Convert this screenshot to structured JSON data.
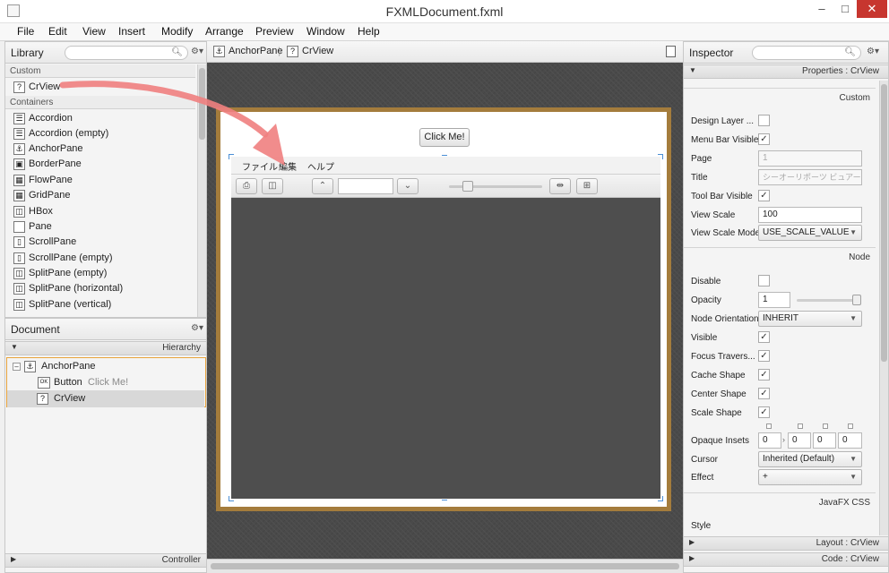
{
  "window": {
    "title": "FXMLDocument.fxml",
    "minimize": "–",
    "maximize": "□",
    "close": "✕"
  },
  "menubar": {
    "items": [
      "File",
      "Edit",
      "View",
      "Insert",
      "Modify",
      "Arrange",
      "Preview",
      "Window",
      "Help"
    ]
  },
  "library": {
    "title": "Library",
    "sections": {
      "custom": "Custom",
      "containers": "Containers"
    },
    "custom_items": [
      {
        "label": "CrView",
        "icon": "?"
      }
    ],
    "container_items": [
      {
        "label": "Accordion",
        "icon": "accordion-icon"
      },
      {
        "label": "Accordion  (empty)",
        "icon": "accordion-icon"
      },
      {
        "label": "AnchorPane",
        "icon": "anchorpane-icon"
      },
      {
        "label": "BorderPane",
        "icon": "borderpane-icon"
      },
      {
        "label": "FlowPane",
        "icon": "flowpane-icon"
      },
      {
        "label": "GridPane",
        "icon": "gridpane-icon"
      },
      {
        "label": "HBox",
        "icon": "hbox-icon"
      },
      {
        "label": "Pane",
        "icon": "pane-icon"
      },
      {
        "label": "ScrollPane",
        "icon": "scrollpane-icon"
      },
      {
        "label": "ScrollPane  (empty)",
        "icon": "scrollpane-icon"
      },
      {
        "label": "SplitPane  (empty)",
        "icon": "splitpane-icon"
      },
      {
        "label": "SplitPane  (horizontal)",
        "icon": "splitpane-icon"
      },
      {
        "label": "SplitPane  (vertical)",
        "icon": "splitpane-icon"
      }
    ]
  },
  "document": {
    "title": "Document",
    "hierarchy_label": "Hierarchy",
    "tree": {
      "root": "AnchorPane",
      "button_type": "Button",
      "button_text": "Click Me!",
      "button_badge": "OK",
      "crview": "CrView"
    },
    "controller_label": "Controller"
  },
  "breadcrumb": {
    "items": [
      "AnchorPane",
      "CrView"
    ]
  },
  "canvas": {
    "button_text": "Click Me!",
    "inner_menu": [
      "ファイル",
      "編集",
      "ヘルプ"
    ]
  },
  "inspector": {
    "title": "Inspector",
    "properties_header": "Properties : CrView",
    "sections": {
      "custom": "Custom",
      "node": "Node",
      "css": "JavaFX CSS"
    },
    "custom_props": {
      "design_layer": {
        "label": "Design Layer ..."
      },
      "menu_bar_visible": {
        "label": "Menu Bar Visible",
        "checked": "✓"
      },
      "page": {
        "label": "Page",
        "value": "1"
      },
      "title": {
        "label": "Title",
        "value": "シーオーリポーツ ビュアー"
      },
      "tool_bar_visible": {
        "label": "Tool Bar Visible",
        "checked": "✓"
      },
      "view_scale": {
        "label": "View Scale",
        "value": "100"
      },
      "view_scale_mode": {
        "label": "View Scale Mode",
        "value": "USE_SCALE_VALUE"
      }
    },
    "node_props": {
      "disable": {
        "label": "Disable"
      },
      "opacity": {
        "label": "Opacity",
        "value": "1",
        "level": 1.0
      },
      "node_orientation": {
        "label": "Node Orientation",
        "value": "INHERIT"
      },
      "visible": {
        "label": "Visible",
        "checked": "✓"
      },
      "focus_traversable": {
        "label": "Focus Travers...",
        "checked": "✓"
      },
      "cache_shape": {
        "label": "Cache Shape",
        "checked": "✓"
      },
      "center_shape": {
        "label": "Center Shape",
        "checked": "✓"
      },
      "scale_shape": {
        "label": "Scale Shape",
        "checked": "✓"
      },
      "opaque_insets": {
        "label": "Opaque Insets",
        "values": [
          "0",
          "0",
          "0",
          "0"
        ]
      },
      "cursor": {
        "label": "Cursor",
        "value": "Inherited (Default)"
      },
      "effect": {
        "label": "Effect",
        "value": "+"
      }
    },
    "css_props": {
      "style": {
        "label": "Style"
      }
    },
    "layout_header": "Layout : CrView",
    "code_header": "Code : CrView"
  },
  "colors": {
    "accent": "#f07f7f",
    "frame": "#a47c3c",
    "selection": "#e8a33c",
    "handles": "#4b8fd6"
  }
}
